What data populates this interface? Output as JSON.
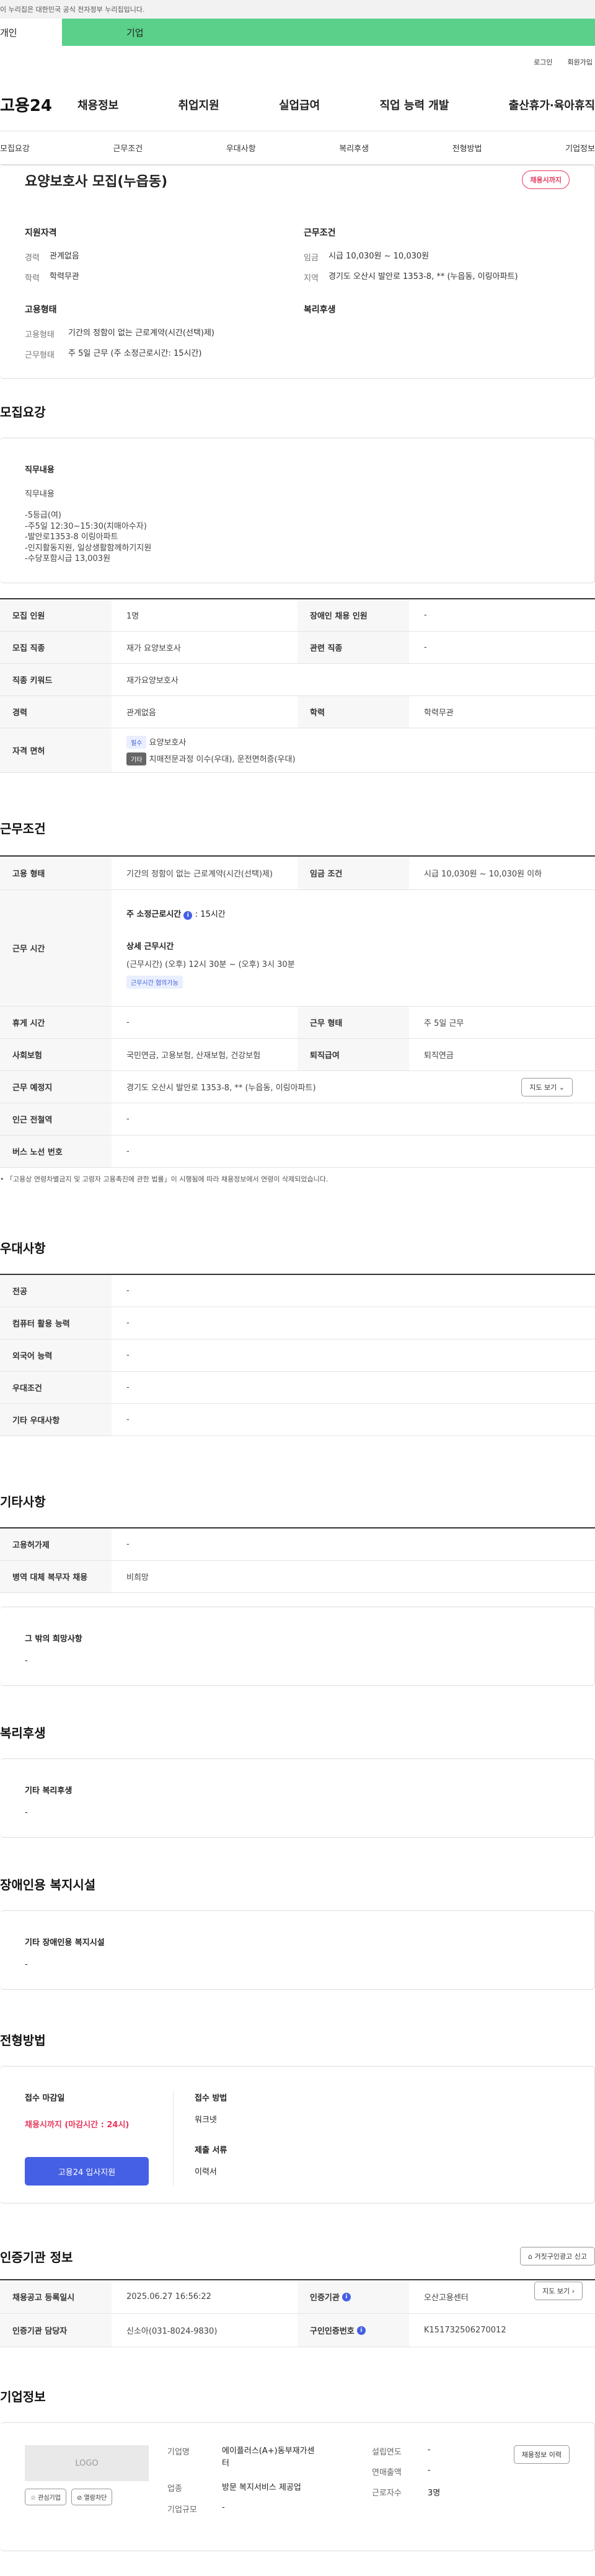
{
  "banner": {
    "text": "이 누리집은 대한민국 공식 전자정부 누리집입니다."
  },
  "user_tabs": [
    {
      "label": "개인"
    },
    {
      "label": "기업"
    }
  ],
  "util": {
    "login": "로그인",
    "join": "회원가입"
  },
  "gnb": {
    "logo": "고용24",
    "items": [
      {
        "label": "채용정보"
      },
      {
        "label": "취업지원"
      },
      {
        "label": "실업급여"
      },
      {
        "label": "직업 능력 개발"
      },
      {
        "label": "출산휴가·육아휴직"
      }
    ]
  },
  "anchor_tabs": [
    {
      "label": "모집요강"
    },
    {
      "label": "근무조건"
    },
    {
      "label": "우대사항"
    },
    {
      "label": "복리후생"
    },
    {
      "label": "전형방법"
    },
    {
      "label": "기업정보"
    }
  ],
  "summary": {
    "title": "요양보호사 모집(누읍동)",
    "status_badge": "채용시까지",
    "qualification": {
      "heading": "지원자격",
      "rows": [
        {
          "k": "경력",
          "v": "관계없음"
        },
        {
          "k": "학력",
          "v": "학력무관"
        }
      ]
    },
    "conditions": {
      "heading": "근무조건",
      "rows": [
        {
          "k": "임금",
          "v": "시급 10,030원 ~ 10,030원"
        },
        {
          "k": "지역",
          "v": "경기도 오산시 발안로 1353-8, ** (누읍동, 이링아파트)"
        }
      ]
    },
    "employment": {
      "heading": "고용형태",
      "rows": [
        {
          "k": "고용형태",
          "v": "기간의 정함이 없는 근로계약(시간(선택)제)"
        },
        {
          "k": "근무형태",
          "v": "주 5일 근무 (주 소정근로시간: 15시간)"
        }
      ]
    },
    "welfare_heading": "복리후생"
  },
  "recruit": {
    "title": "모집요강",
    "duty_heading": "직무내용",
    "duty_sub": "직무내용",
    "duty_lines": [
      "-5등급(여)",
      "-주5일 12:30~15:30(치매아수자)",
      "-발안로1353-8 이링아파트",
      "-인지활동지원, 일상생활함께하기지원",
      "-수당포함시급 13,003원"
    ],
    "rows": {
      "count_label": "모집 인원",
      "count": "1명",
      "disabled_label": "장애인 채용 인원",
      "disabled": "-",
      "job_label": "모집 직종",
      "job": "재가 요양보호사",
      "related_label": "관련 직종",
      "related": "-",
      "keyword_label": "직종 키워드",
      "keyword": "재가요양보호사",
      "career_label": "경력",
      "career": "관계없음",
      "edu_label": "학력",
      "edu": "학력무관",
      "license_label": "자격 면허",
      "license_tag1": "필수",
      "license1": "요양보호사",
      "license_tag2": "기타",
      "license2": "치매전문과정 이수(우대), 운전면허증(우대)"
    }
  },
  "work": {
    "title": "근무조건",
    "type_label": "고용 형태",
    "type": "기간의 정함이 없는 근로계약(시간(선택)제)",
    "wage_label": "임금 조건",
    "wage": "시급 10,030원 ~ 10,030원 이하",
    "hours_label": "근무 시간",
    "weekly_label": "주 소정근로시간",
    "weekly": ": 15시간",
    "detail_label": "상세 근무시간",
    "detail": "(근무시간) (오후) 12시 30분 ~ (오후) 3시 30분",
    "detail_tag": "근무시간 협의가능",
    "rest_label": "휴게 시간",
    "rest": "-",
    "shape_label": "근무 형태",
    "shape": "주 5일 근무",
    "insurance_label": "사회보험",
    "insurance": "국민연금, 고용보험, 산재보험, 건강보험",
    "severance_label": "퇴직급여",
    "severance": "퇴직연금",
    "place_label": "근무 예정지",
    "place": "경기도 오산시 발안로 1353-8, ** (누읍동, 이링아파트)",
    "map_button": "지도 보기",
    "subway_label": "인근 전철역",
    "subway": "-",
    "bus_label": "버스 노선 번호",
    "bus": "-",
    "note": "「고용상 연령차별금지 및 고령자 고용촉진에 관한 법률」이 시행됨에 따라 채용정보에서 연령이 삭제되었습니다."
  },
  "pref": {
    "title": "우대사항",
    "major_label": "전공",
    "major": "-",
    "computer_label": "컴퓨터 활용 능력",
    "computer": "-",
    "lang_label": "외국어 능력",
    "lang": "-",
    "cond_label": "우대조건",
    "cond": "-",
    "etc_label": "기타 우대사항",
    "etc": "-"
  },
  "etc": {
    "title": "기타사항",
    "emp_label": "고용허가제",
    "emp": "-",
    "military_label": "병역 대체 복무자 채용",
    "military": "비희망",
    "wish_heading": "그 밖의 희망사항",
    "wish": "-"
  },
  "benefit": {
    "title": "복리후생",
    "heading": "기타 복리후생",
    "value": "-"
  },
  "facility": {
    "title": "장애인용 복지시설",
    "heading": "기타 장애인용 복지시설",
    "value": "-"
  },
  "process": {
    "title": "전형방법",
    "deadline_label": "접수 마감일",
    "deadline": "채용시까지 (마감시간 : 24시)",
    "apply_button": "고용24 입사지원",
    "method_label": "접수 방법",
    "method": "워크넷",
    "docs_label": "제출 서류",
    "docs": "이력서"
  },
  "agency": {
    "title": "인증기관 정보",
    "report_button": "거짓구인광고 신고",
    "reg_label": "채용공고 등록일시",
    "reg": "2025.06.27 16:56:22",
    "cert_label": "인증기관",
    "cert": "오산고용센터",
    "map_button": "지도 보기",
    "manager_label": "인증기관 담당자",
    "manager": "신소아(031-8024-9830)",
    "number_label": "구인인증번호",
    "number": "K151732506270012"
  },
  "company": {
    "title": "기업정보",
    "logo_text": "LOGO",
    "fav_button": "관심기업",
    "block_button": "열람차단",
    "name_label": "기업명",
    "name": "에이플러스(A+)동부재가센터",
    "founded_label": "설립연도",
    "founded": "-",
    "sales_label": "연매출액",
    "sales": "-",
    "industry_label": "업종",
    "industry": "방문 복지서비스 제공업",
    "staff_label": "근로자수",
    "staff": "3명",
    "size_label": "기업규모",
    "size": "-",
    "jobs_button": "채용정보 이력"
  },
  "colors": {
    "accent_blue": "#4560e4",
    "accent_red": "#e8375c",
    "user_tab_green": "#5ad08a"
  }
}
